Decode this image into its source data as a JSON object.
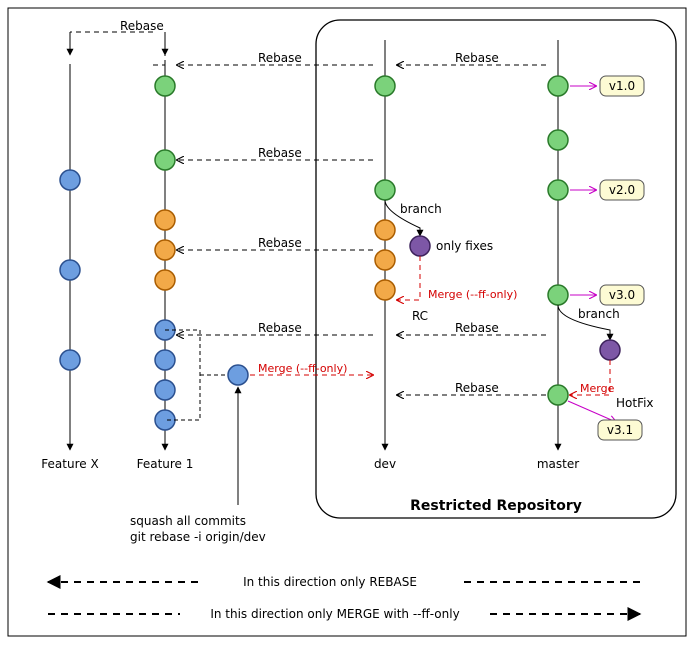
{
  "branches": {
    "featureX": "Feature X",
    "feature1": "Feature 1",
    "dev": "dev",
    "master": "master",
    "rc": "RC",
    "hotfix": "HotFix"
  },
  "labels": {
    "rebase": "Rebase",
    "branch": "branch",
    "only_fixes": "only fixes",
    "merge_ff": "Merge (--ff-only)",
    "merge": "Merge",
    "squash1": "squash all commits",
    "squash2": "git rebase -i origin/dev",
    "restricted": "Restricted Repository",
    "dir_rebase": "In this direction only REBASE",
    "dir_merge": "In this direction only MERGE with --ff-only"
  },
  "tags": {
    "v10": "v1.0",
    "v20": "v2.0",
    "v30": "v3.0",
    "v31": "v3.1"
  },
  "colors": {
    "green": "#7bd27b",
    "green_stroke": "#2a7a2a",
    "blue": "#6d9ee0",
    "blue_stroke": "#2b508f",
    "orange": "#f2a948",
    "orange_stroke": "#aa5d00",
    "purple": "#7d57a6",
    "purple_stroke": "#3e235d",
    "magenta": "#c700c7"
  },
  "chart_data": {
    "type": "diagram",
    "lanes": [
      {
        "name": "Feature X",
        "commits": [
          {
            "c": "blue"
          },
          {
            "c": "blue"
          },
          {
            "c": "blue"
          }
        ]
      },
      {
        "name": "Feature 1",
        "commits": [
          {
            "c": "green"
          },
          {
            "c": "green"
          },
          {
            "c": "orange"
          },
          {
            "c": "orange"
          },
          {
            "c": "orange"
          },
          {
            "c": "blue"
          },
          {
            "c": "blue"
          },
          {
            "c": "blue"
          },
          {
            "c": "blue"
          }
        ]
      },
      {
        "name": "dev",
        "commits": [
          {
            "c": "green"
          },
          {
            "c": "green"
          },
          {
            "c": "orange"
          },
          {
            "c": "orange"
          },
          {
            "c": "orange"
          }
        ]
      },
      {
        "name": "RC",
        "parent": "dev",
        "commits": [
          {
            "c": "purple"
          }
        ],
        "label": "only fixes",
        "merge_back_to": "dev",
        "merge_style": "--ff-only"
      },
      {
        "name": "master",
        "commits": [
          {
            "c": "green",
            "tag": "v1.0"
          },
          {
            "c": "green"
          },
          {
            "c": "green",
            "tag": "v2.0"
          },
          {
            "c": "green",
            "tag": "v3.0"
          },
          {
            "c": "green",
            "tag": "v3.1",
            "via": "HotFix merge"
          }
        ]
      },
      {
        "name": "HotFix",
        "parent": "master",
        "commits": [
          {
            "c": "purple"
          }
        ],
        "merge_back_to": "master"
      }
    ],
    "rebase_edges": [
      {
        "from": "dev",
        "to": "Feature X"
      },
      {
        "from": "dev",
        "to": "Feature 1",
        "count": 3
      },
      {
        "from": "master",
        "to": "dev",
        "count": 3
      }
    ],
    "merge_edges": [
      {
        "from": "Feature 1",
        "to": "dev",
        "style": "--ff-only"
      },
      {
        "from": "RC",
        "to": "dev",
        "style": "--ff-only"
      },
      {
        "from": "HotFix",
        "to": "master"
      }
    ],
    "notes": [
      "squash all commits",
      "git rebase -i origin/dev"
    ],
    "legend": [
      "In this direction only REBASE (right→left)",
      "In this direction only MERGE with --ff-only (left→right)"
    ],
    "restricted_scope": [
      "dev",
      "RC",
      "master",
      "HotFix"
    ]
  }
}
